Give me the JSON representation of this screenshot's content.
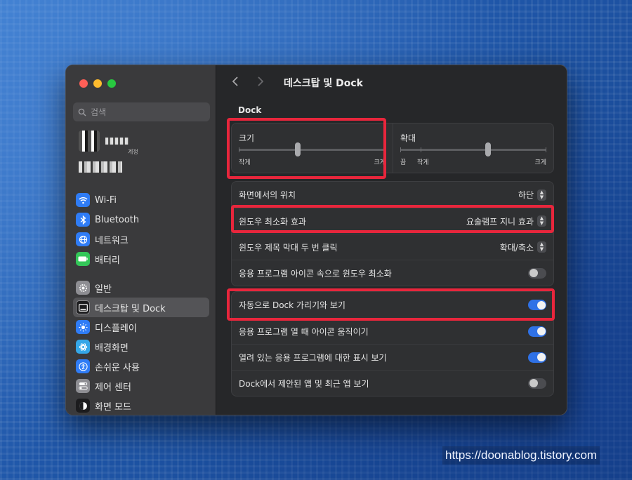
{
  "window": {
    "title": "데스크탑 및 Dock"
  },
  "sidebar": {
    "search_placeholder": "검색",
    "account_sub": "계정",
    "items": [
      {
        "label": "Wi-Fi",
        "icon": "wifi-icon",
        "color": "#2f7cf6"
      },
      {
        "label": "Bluetooth",
        "icon": "bluetooth-icon",
        "color": "#2f7cf6"
      },
      {
        "label": "네트워크",
        "icon": "globe-icon",
        "color": "#2f7cf6"
      },
      {
        "label": "배터리",
        "icon": "battery-icon",
        "color": "#34c759"
      },
      {
        "label": "일반",
        "icon": "gear-icon",
        "color": "#8e8e93"
      },
      {
        "label": "데스크탑 및 Dock",
        "icon": "dock-icon",
        "color": "#1c1c1e",
        "active": true
      },
      {
        "label": "디스플레이",
        "icon": "sun-icon",
        "color": "#2f7cf6"
      },
      {
        "label": "배경화면",
        "icon": "flower-icon",
        "color": "#35a7e8"
      },
      {
        "label": "손쉬운 사용",
        "icon": "accessibility-icon",
        "color": "#2f7cf6"
      },
      {
        "label": "제어 센터",
        "icon": "switches-icon",
        "color": "#8e8e93"
      },
      {
        "label": "화면 모드",
        "icon": "appearance-icon",
        "color": "#1c1c1e"
      }
    ]
  },
  "dock": {
    "section_title": "Dock",
    "size": {
      "label": "크기",
      "min_label": "작게",
      "max_label": "크게",
      "value": 0.4
    },
    "magnify": {
      "label": "확대",
      "off_label": "끔",
      "min_label": "작게",
      "max_label": "크게",
      "value": 0.6
    },
    "rows": [
      {
        "label": "화면에서의 위치",
        "value": "하단",
        "type": "popup"
      },
      {
        "label": "윈도우 최소화 효과",
        "value": "요술램프 지니 효과",
        "type": "popup"
      },
      {
        "label": "윈도우 제목 막대 두 번 클릭",
        "value": "확대/축소",
        "type": "popup"
      },
      {
        "label": "응용 프로그램 아이콘 속으로 윈도우 최소화",
        "type": "toggle",
        "on": false
      }
    ],
    "rows2": [
      {
        "label": "자동으로 Dock 가리기와 보기",
        "type": "toggle",
        "on": true
      },
      {
        "label": "응용 프로그램 열 때 아이콘 움직이기",
        "type": "toggle",
        "on": true
      },
      {
        "label": "열려 있는 응용 프로그램에 대한 표시 보기",
        "type": "toggle",
        "on": true
      },
      {
        "label": "Dock에서 제안된 앱 및 최근 앱 보기",
        "type": "toggle",
        "on": false
      }
    ]
  },
  "watermark": "https://doonablog.tistory.com",
  "colors": {
    "accent": "#2f71e6",
    "highlight": "#e8263c"
  }
}
